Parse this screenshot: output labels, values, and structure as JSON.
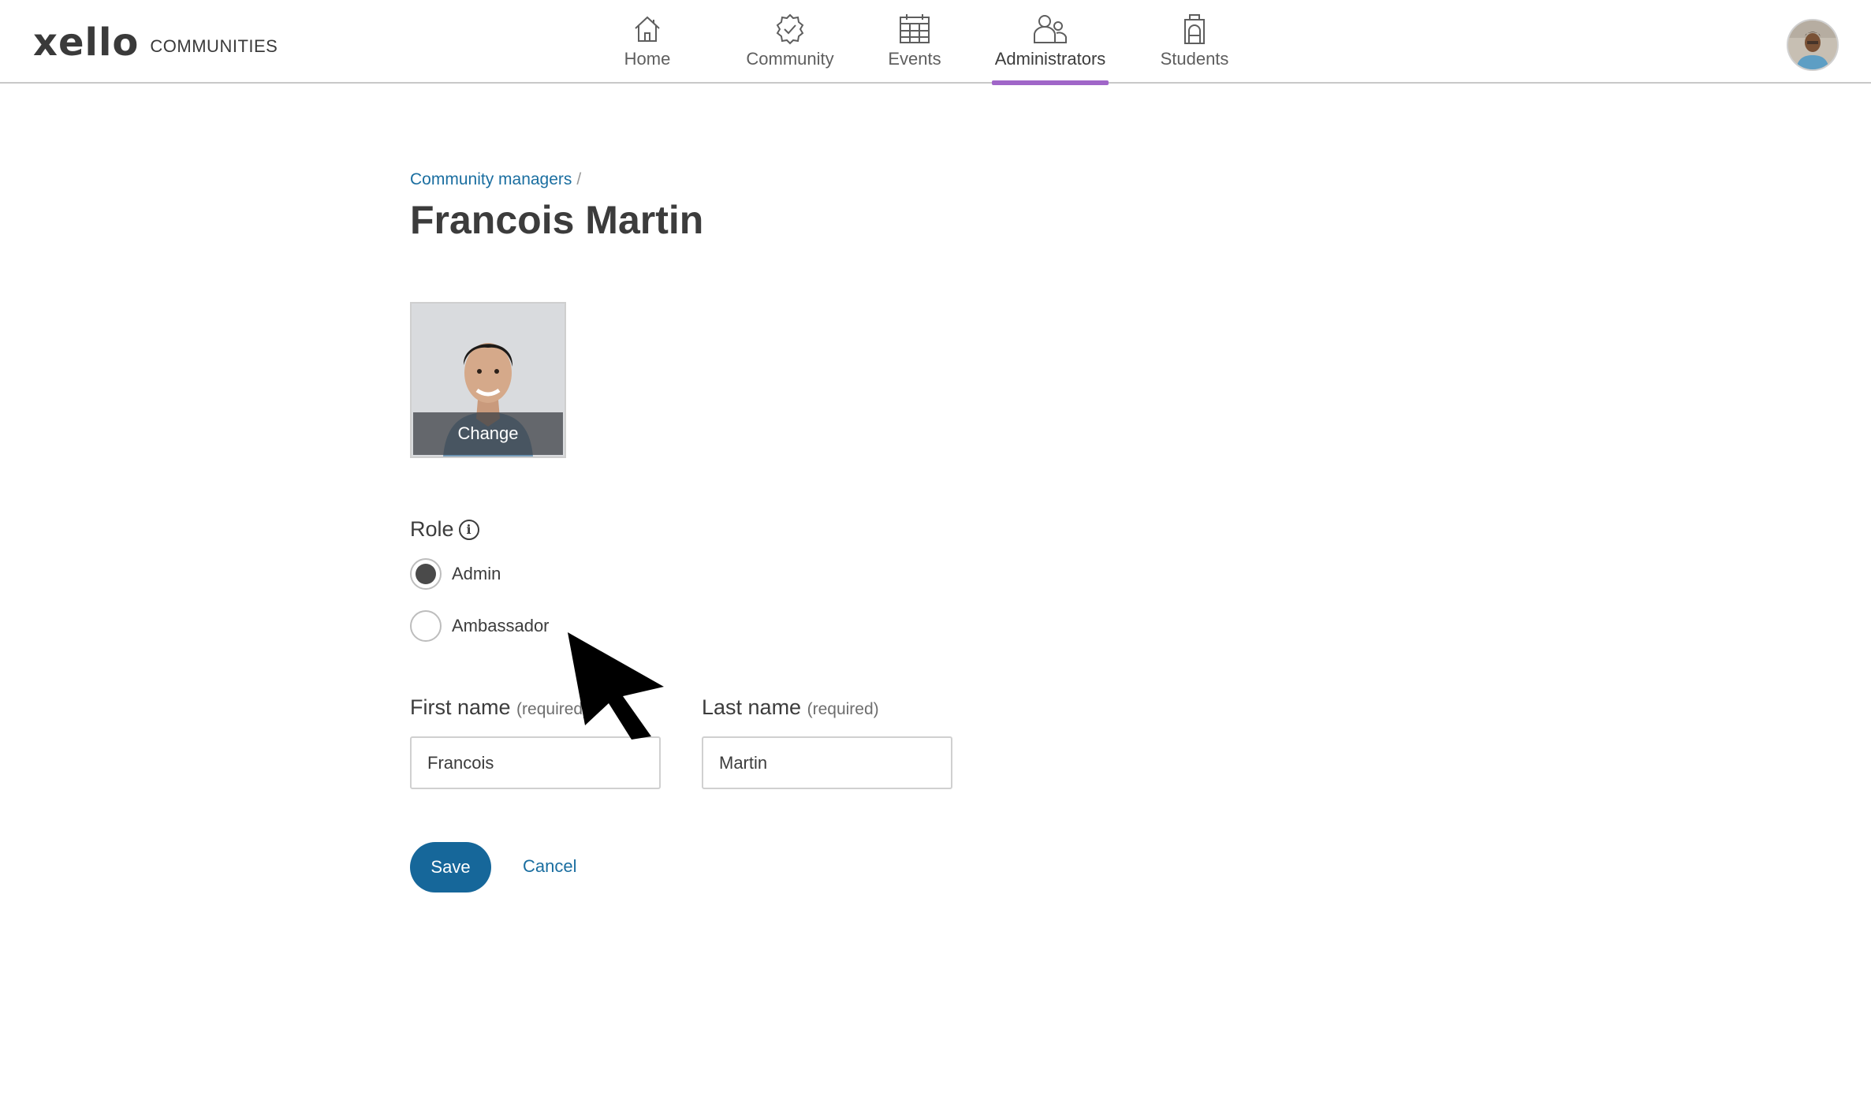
{
  "brand": {
    "wordmark": "xello",
    "product": "COMMUNITIES",
    "accent_color": "#a066c8",
    "link_color": "#1a6ea0",
    "button_color": "#16679a"
  },
  "nav": {
    "items": [
      {
        "label": "Home",
        "icon": "home-icon"
      },
      {
        "label": "Community",
        "icon": "verified-badge-icon"
      },
      {
        "label": "Events",
        "icon": "calendar-icon"
      },
      {
        "label": "Administrators",
        "icon": "people-icon",
        "active": true
      },
      {
        "label": "Students",
        "icon": "backpack-icon"
      }
    ]
  },
  "breadcrumb": {
    "parent": "Community managers",
    "separator": "/"
  },
  "page": {
    "title": "Francois Martin"
  },
  "photo": {
    "change_label": "Change"
  },
  "role": {
    "label": "Role",
    "info_icon": "i",
    "options": [
      {
        "label": "Admin",
        "selected": true
      },
      {
        "label": "Ambassador",
        "selected": false
      }
    ]
  },
  "form": {
    "first_name": {
      "label": "First name",
      "required_note": "(required)",
      "value": "Francois"
    },
    "last_name": {
      "label": "Last name",
      "required_note": "(required)",
      "value": "Martin"
    }
  },
  "actions": {
    "save": "Save",
    "cancel": "Cancel"
  }
}
